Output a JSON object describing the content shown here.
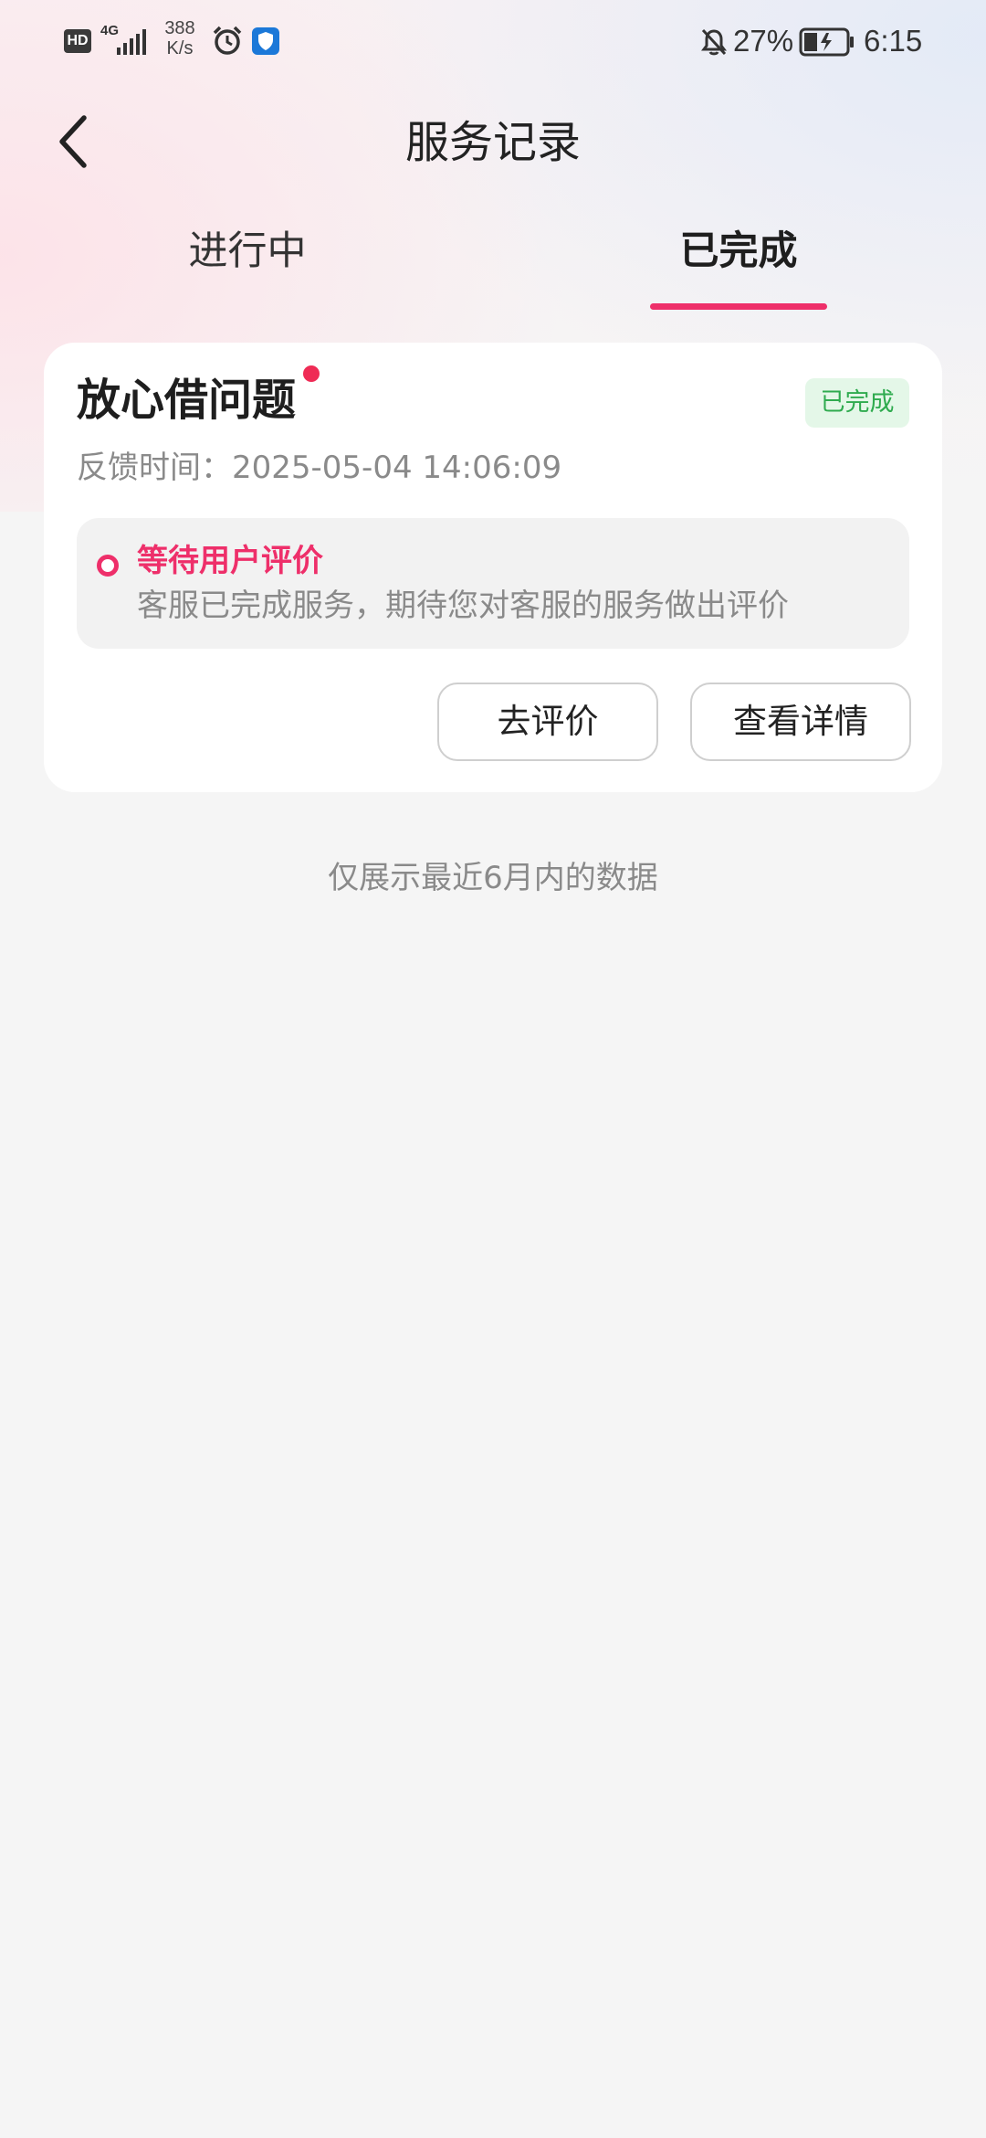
{
  "status_bar": {
    "hd_label": "HD",
    "network_type": "4G",
    "network_speed": "388 K/s",
    "battery_percent": "27%",
    "time": "6:15",
    "icons": [
      "hd-icon",
      "signal-icon",
      "alarm-icon",
      "shield-icon",
      "bell-off-icon",
      "battery-charging-icon"
    ]
  },
  "header": {
    "title": "服务记录",
    "back_icon": "chevron-left-icon"
  },
  "tabs": [
    {
      "label": "进行中",
      "active": false
    },
    {
      "label": "已完成",
      "active": true
    }
  ],
  "record": {
    "title": "放心借问题",
    "has_unread_dot": true,
    "status": "已完成",
    "feedback_time": "反馈时间：2025-05-04 14:06:09",
    "progress": {
      "title": "等待用户评价",
      "description": "客服已完成服务，期待您对客服的服务做出评价"
    },
    "actions": {
      "rate": "去评价",
      "detail": "查看详情"
    }
  },
  "footer_note": "仅展示最近6月内的数据",
  "colors": {
    "accent": "#ee2f6a",
    "status_green": "#2fab4f",
    "status_green_bg": "#e4f7e8",
    "page_bg": "#f5f5f5"
  }
}
